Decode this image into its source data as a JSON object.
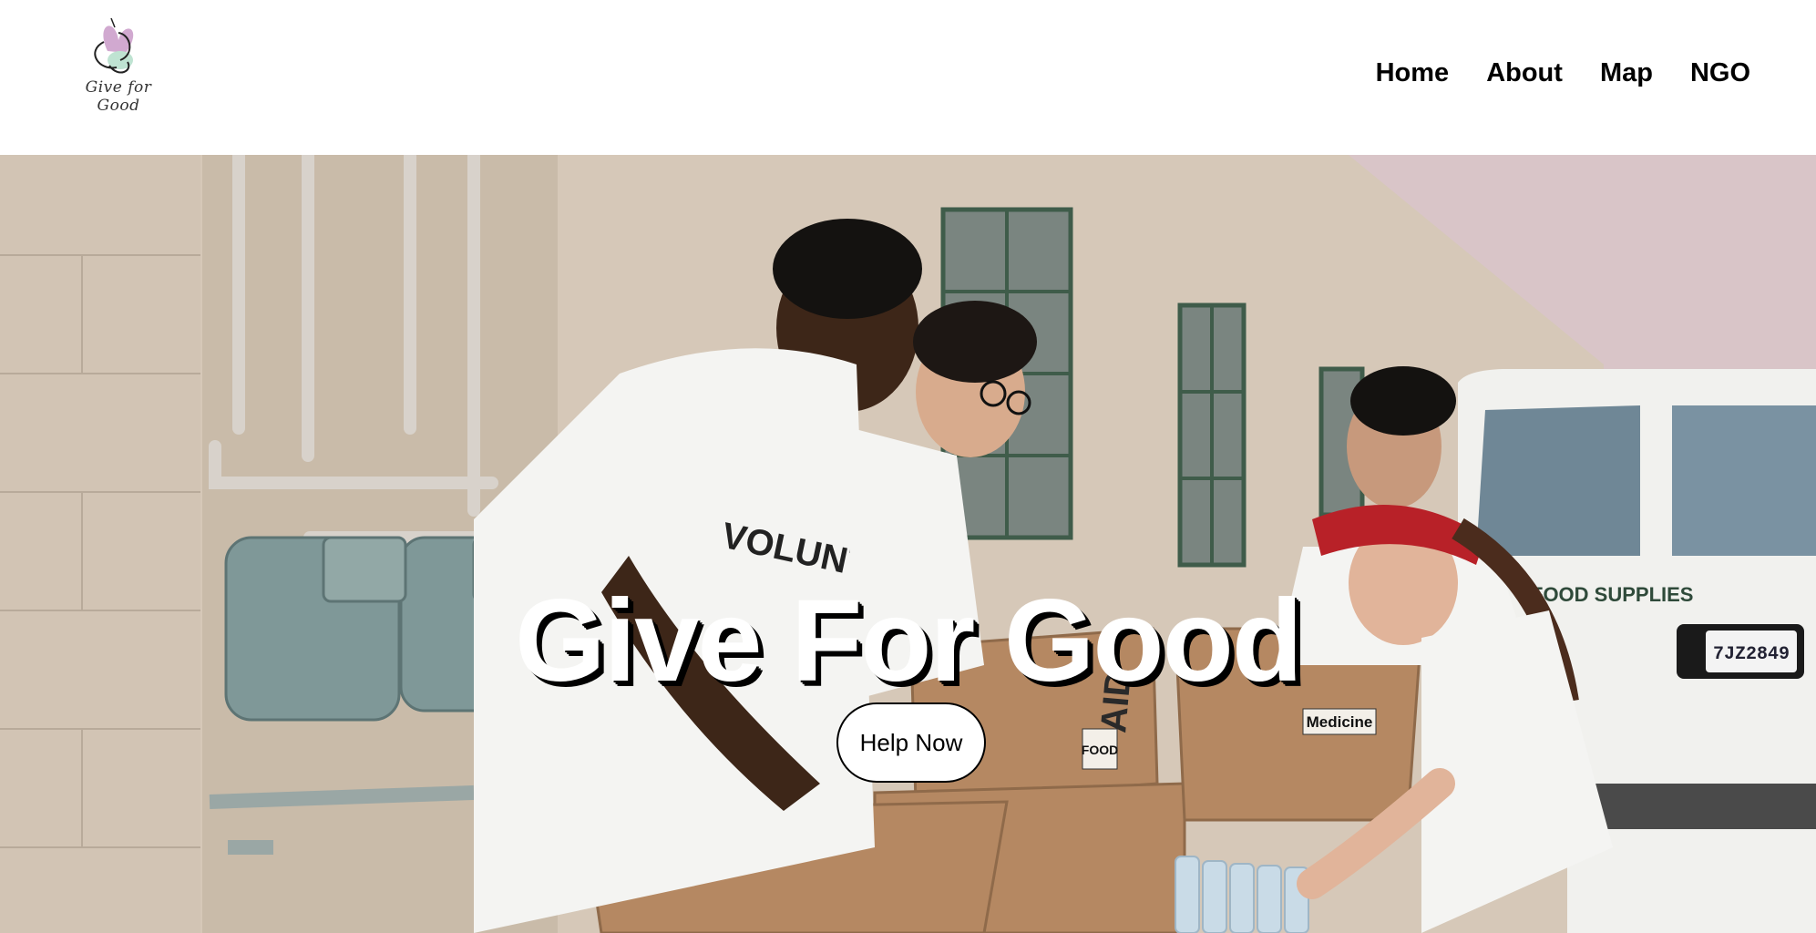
{
  "header": {
    "logo_text": "Give for Good",
    "nav": [
      {
        "label": "Home"
      },
      {
        "label": "About"
      },
      {
        "label": "Map"
      },
      {
        "label": "NGO"
      }
    ]
  },
  "hero": {
    "title": "Give For Good",
    "cta_label": "Help Now",
    "box_labels": {
      "food": "FOOD",
      "medicine": "Medicine",
      "aid": "AID"
    },
    "shirt_text": "VOLUNTEER",
    "van_text": "FOOD SUPPLIES",
    "license_plate": "7JZ2849"
  },
  "colors": {
    "header_bg": "#ffffff",
    "nav_text": "#000000",
    "hero_title": "#ffffff",
    "button_bg": "#ffffff",
    "logo_purple": "#c99ac8",
    "logo_mint": "#bfe3d2"
  }
}
